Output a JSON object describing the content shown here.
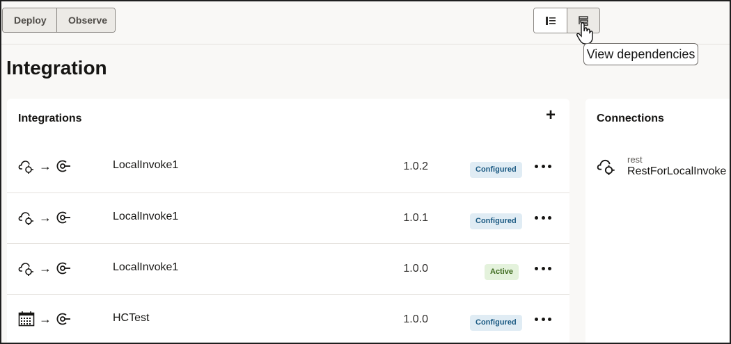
{
  "toolbar": {
    "deploy_label": "Deploy",
    "observe_label": "Observe",
    "view_buttons": [
      "list-view-icon",
      "dependencies-view-icon"
    ],
    "tooltip": "View dependencies"
  },
  "page": {
    "title": "Integration"
  },
  "integrations": {
    "title": "Integrations",
    "add_label": "+",
    "rows": [
      {
        "trigger_icon": "cloud-adapter-icon",
        "arrow": "→",
        "invoke_icon": "invoke-icon",
        "name": "LocalInvoke1",
        "version": "1.0.2",
        "status": "Configured"
      },
      {
        "trigger_icon": "cloud-adapter-icon",
        "arrow": "→",
        "invoke_icon": "invoke-icon",
        "name": "LocalInvoke1",
        "version": "1.0.1",
        "status": "Configured"
      },
      {
        "trigger_icon": "cloud-adapter-icon",
        "arrow": "→",
        "invoke_icon": "invoke-icon",
        "name": "LocalInvoke1",
        "version": "1.0.0",
        "status": "Active"
      },
      {
        "trigger_icon": "calendar-schedule-icon",
        "arrow": "→",
        "invoke_icon": "invoke-icon",
        "name": "HCTest",
        "version": "1.0.0",
        "status": "Configured"
      }
    ]
  },
  "connections": {
    "title": "Connections",
    "items": [
      {
        "icon": "cloud-adapter-icon",
        "type": "rest",
        "name": "RestForLocalInvoke"
      }
    ]
  },
  "colors": {
    "configured_bg": "#e0ecf4",
    "configured_text": "#1b5a83",
    "active_bg": "#e4f2dc",
    "active_text": "#3d6a1e"
  }
}
